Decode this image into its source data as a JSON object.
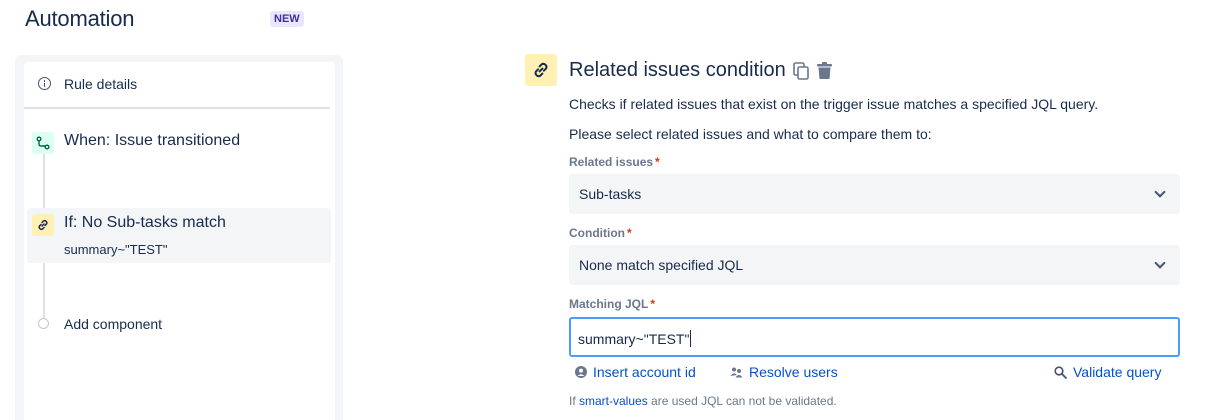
{
  "header": {
    "title": "Automation",
    "badge": "NEW"
  },
  "sidebar": {
    "rule_details_label": "Rule details",
    "steps": [
      {
        "type": "trigger",
        "title": "When: Issue transitioned",
        "icon": "trigger-icon"
      },
      {
        "type": "condition",
        "title": "If: No Sub-tasks match",
        "subtitle": "summary~\"TEST\"",
        "icon": "link-icon"
      },
      {
        "type": "add",
        "title": "Add component"
      }
    ]
  },
  "panel": {
    "title": "Related issues condition",
    "description": "Checks if related issues that exist on the trigger issue matches a specified JQL query.",
    "instruction": "Please select related issues and what to compare them to:",
    "related_issues": {
      "label": "Related issues",
      "value": "Sub-tasks"
    },
    "condition": {
      "label": "Condition",
      "value": "None match specified JQL"
    },
    "matching_jql": {
      "label": "Matching JQL",
      "value": "summary~\"TEST\""
    },
    "required_marker": "*",
    "links": {
      "insert_account_id": "Insert account id",
      "resolve_users": "Resolve users",
      "validate_query": "Validate query"
    },
    "hint": {
      "prefix": "If",
      "link": "smart-values",
      "suffix": "are used JQL can not be validated."
    }
  },
  "colors": {
    "accent": "#0052CC",
    "condition_icon_bg": "#FFF0B3",
    "trigger_icon_bg": "#DCFFF1",
    "required": "#DE350B",
    "focus_border": "#4C9AFF"
  }
}
